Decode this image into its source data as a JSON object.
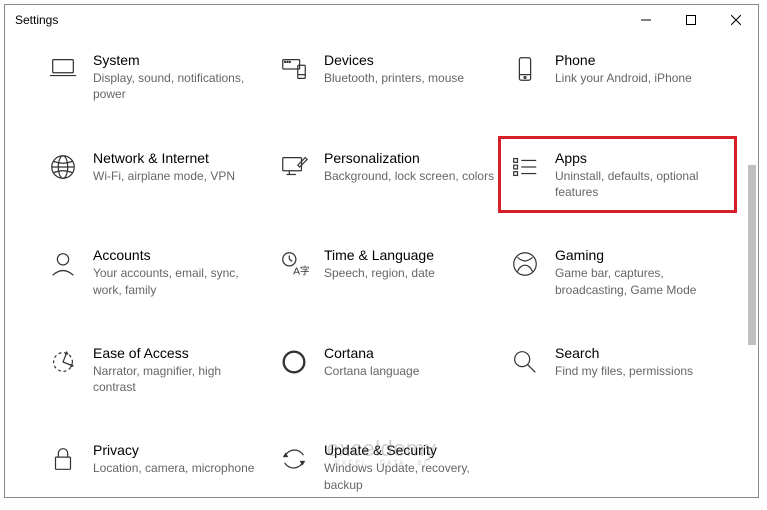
{
  "window": {
    "title": "Settings"
  },
  "tiles": {
    "system": {
      "title": "System",
      "sub": "Display, sound, notifications, power"
    },
    "devices": {
      "title": "Devices",
      "sub": "Bluetooth, printers, mouse"
    },
    "phone": {
      "title": "Phone",
      "sub": "Link your Android, iPhone"
    },
    "network": {
      "title": "Network & Internet",
      "sub": "Wi-Fi, airplane mode, VPN"
    },
    "personal": {
      "title": "Personalization",
      "sub": "Background, lock screen, colors"
    },
    "apps": {
      "title": "Apps",
      "sub": "Uninstall, defaults, optional features"
    },
    "accounts": {
      "title": "Accounts",
      "sub": "Your accounts, email, sync, work, family"
    },
    "time": {
      "title": "Time & Language",
      "sub": "Speech, region, date"
    },
    "gaming": {
      "title": "Gaming",
      "sub": "Game bar, captures, broadcasting, Game Mode"
    },
    "ease": {
      "title": "Ease of Access",
      "sub": "Narrator, magnifier, high contrast"
    },
    "cortana": {
      "title": "Cortana",
      "sub": "Cortana language"
    },
    "search": {
      "title": "Search",
      "sub": "Find my files, permissions"
    },
    "privacy": {
      "title": "Privacy",
      "sub": "Location, camera, microphone"
    },
    "update": {
      "title": "Update & Security",
      "sub": "Windows Update, recovery, backup"
    }
  },
  "watermark": {
    "main": "exceldemy",
    "sub": "EXCEL · DATA · BI"
  }
}
